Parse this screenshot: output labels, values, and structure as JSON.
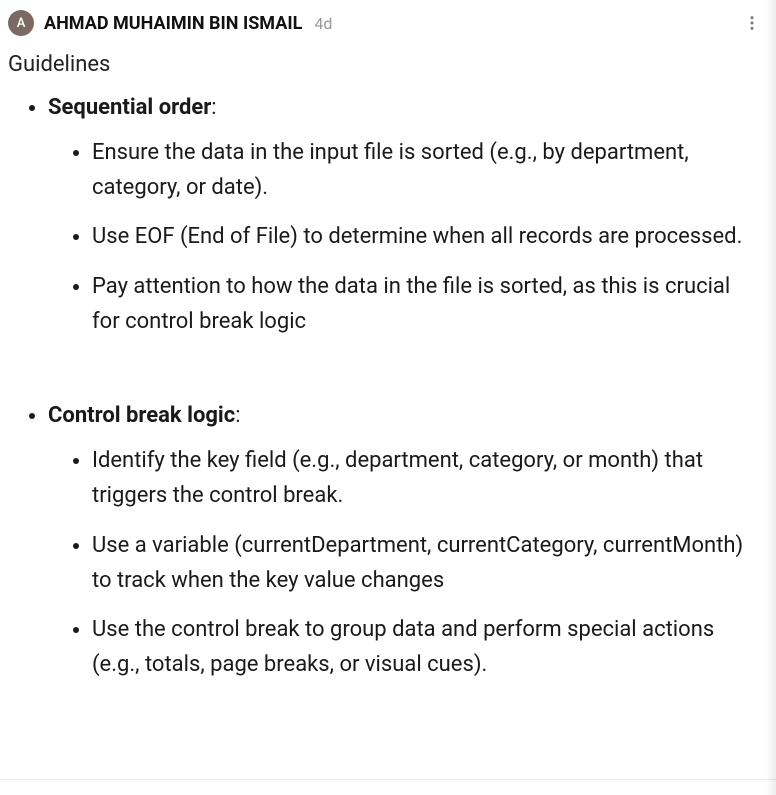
{
  "header": {
    "avatar_letter": "A",
    "author": "AHMAD MUHAIMIN BIN ISMAIL",
    "timestamp": "4d"
  },
  "title": "Guidelines",
  "sections": [
    {
      "label": "Sequential order",
      "colon": ":",
      "items": [
        "Ensure the data in the input file is sorted (e.g., by department, category, or date).",
        "Use EOF (End of File) to determine when all records are processed.",
        "Pay attention to how the data in the file is sorted, as this is crucial for control break logic"
      ]
    },
    {
      "label": "Control break logic",
      "colon": ":",
      "items": [
        "Identify the key field (e.g., department, category, or month) that triggers the control break.",
        "Use a variable (currentDepartment, currentCategory, currentMonth) to track when the key value changes",
        "Use the control break to group data and perform special actions (e.g., totals, page breaks, or visual cues)."
      ]
    }
  ]
}
